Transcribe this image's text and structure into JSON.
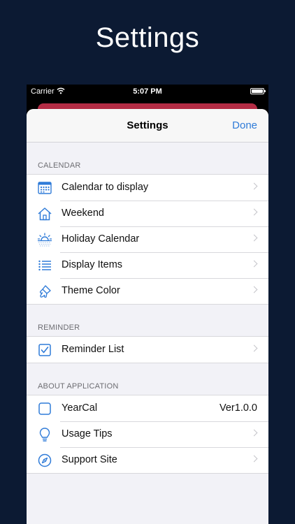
{
  "promo": {
    "title": "Settings"
  },
  "status_bar": {
    "carrier": "Carrier",
    "time": "5:07 PM"
  },
  "nav": {
    "title": "Settings",
    "done_label": "Done"
  },
  "sections": {
    "calendar": {
      "header": "CALENDAR",
      "items": [
        {
          "label": "Calendar to display",
          "icon": "calendar-grid-icon"
        },
        {
          "label": "Weekend",
          "icon": "house-icon"
        },
        {
          "label": "Holiday Calendar",
          "icon": "sunrise-icon"
        },
        {
          "label": "Display Items",
          "icon": "list-icon"
        },
        {
          "label": "Theme Color",
          "icon": "paintbrush-icon"
        }
      ]
    },
    "reminder": {
      "header": "REMINDER",
      "items": [
        {
          "label": "Reminder List",
          "icon": "checkbox-icon"
        }
      ]
    },
    "about": {
      "header": "ABOUT APPLICATION",
      "items": [
        {
          "label": "YearCal",
          "value": "Ver1.0.0",
          "icon": "app-square-icon"
        },
        {
          "label": "Usage Tips",
          "icon": "lightbulb-icon"
        },
        {
          "label": "Support Site",
          "icon": "compass-icon"
        }
      ]
    }
  },
  "colors": {
    "accent": "#2f7bd8",
    "background": "#0c1a33",
    "underlay": "#c6314b"
  }
}
